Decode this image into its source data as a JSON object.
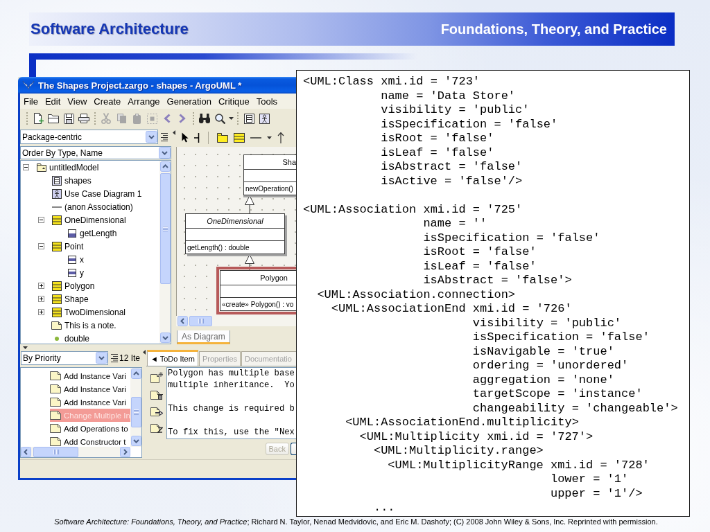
{
  "header": {
    "title": "Software Architecture",
    "subtitle": "Foundations, Theory, and Practice"
  },
  "window": {
    "title": "The Shapes Project.zargo - shapes - ArgoUML *",
    "menu": [
      "File",
      "Edit",
      "View",
      "Create",
      "Arrange",
      "Generation",
      "Critique",
      "Tools"
    ],
    "toolbar": [
      {
        "kind": "new",
        "disabled": false
      },
      {
        "kind": "open",
        "disabled": false
      },
      {
        "kind": "save",
        "disabled": false
      },
      {
        "kind": "print",
        "disabled": false
      },
      {
        "kind": "separator"
      },
      {
        "kind": "cut",
        "disabled": true
      },
      {
        "kind": "copy",
        "disabled": true
      },
      {
        "kind": "paste",
        "disabled": true
      },
      {
        "kind": "remove",
        "disabled": true
      },
      {
        "kind": "back",
        "disabled": false
      },
      {
        "kind": "forward",
        "disabled": false
      },
      {
        "kind": "separator"
      },
      {
        "kind": "find",
        "disabled": false
      },
      {
        "kind": "zoom",
        "disabled": false
      },
      {
        "kind": "dropdown",
        "disabled": false
      },
      {
        "kind": "separator"
      },
      {
        "kind": "class-diagram",
        "disabled": false
      },
      {
        "kind": "usecase-diagram",
        "disabled": false
      }
    ],
    "explorer": {
      "perspective": "Package-centric",
      "ordering": "Order By Type, Name",
      "tree": [
        {
          "label": "untitledModel",
          "kind": "model",
          "expanded": true,
          "selected": false,
          "children": [
            {
              "label": "shapes",
              "kind": "class-diagram",
              "selected": false
            },
            {
              "label": "Use Case Diagram 1",
              "kind": "usecase-diagram",
              "selected": false
            },
            {
              "label": "(anon Association)",
              "kind": "association",
              "selected": false
            },
            {
              "label": "OneDimensional",
              "kind": "class",
              "expanded": true,
              "selected": false,
              "children": [
                {
                  "label": "getLength",
                  "kind": "operation",
                  "selected": false
                }
              ]
            },
            {
              "label": "Point",
              "kind": "class",
              "expanded": true,
              "selected": false,
              "children": [
                {
                  "label": "x",
                  "kind": "attribute",
                  "selected": false
                },
                {
                  "label": "y",
                  "kind": "attribute",
                  "selected": false
                }
              ]
            },
            {
              "label": "Polygon",
              "kind": "class",
              "expanded": false,
              "selected": false
            },
            {
              "label": "Shape",
              "kind": "class",
              "expanded": false,
              "selected": false
            },
            {
              "label": "TwoDimensional",
              "kind": "class",
              "expanded": false,
              "selected": false
            },
            {
              "label": "This is a note.",
              "kind": "note",
              "selected": false
            },
            {
              "label": "double",
              "kind": "datatype",
              "selected": false
            }
          ]
        }
      ]
    },
    "diagram": {
      "toolbar": [
        {
          "kind": "select"
        },
        {
          "kind": "comment"
        },
        {
          "kind": "separator"
        },
        {
          "kind": "package"
        },
        {
          "kind": "class"
        },
        {
          "kind": "association"
        },
        {
          "kind": "dropdown"
        },
        {
          "kind": "generalization"
        }
      ],
      "classes": [
        {
          "name": "Sha",
          "operations": [
            "newOperation()"
          ],
          "abstract": false,
          "selected": false
        },
        {
          "name": "OneDimensional",
          "operations": [
            "getLength() : double"
          ],
          "abstract": true,
          "selected": false
        },
        {
          "name": "Polygon",
          "operations": [
            "«create» Polygon() : vo"
          ],
          "abstract": false,
          "selected": true
        }
      ],
      "tabs": [
        {
          "label": "As Diagram",
          "selected": true
        }
      ]
    },
    "todo": {
      "grouping": "By Priority",
      "count": "12 Ite",
      "items": [
        {
          "label": "Add Instance Vari",
          "selected": false
        },
        {
          "label": "Add Instance Vari",
          "selected": false
        },
        {
          "label": "Add Instance Vari",
          "selected": false
        },
        {
          "label": "Change Multiple In",
          "selected": true
        },
        {
          "label": "Add Operations to",
          "selected": false
        },
        {
          "label": "Add Constructor t",
          "selected": false
        }
      ]
    },
    "details": {
      "tabs": [
        {
          "label": "◄ ToDo Item",
          "selected": true,
          "disabled": false
        },
        {
          "label": "Properties",
          "selected": false,
          "disabled": true
        },
        {
          "label": "Documentatio",
          "selected": false,
          "disabled": true
        }
      ],
      "text": [
        [
          "Polygon has multiple base",
          "multiple inheritance.  Yo"
        ],
        [
          "This change is required b"
        ],
        [
          "To fix this, use the \"Nex"
        ]
      ],
      "buttons": [
        {
          "label": "Back",
          "disabled": true
        }
      ]
    }
  },
  "xmi": [
    {
      "lines": [
        "<UML:Class xmi.id = '723'",
        "name = 'Data Store'",
        "visibility = 'public'",
        "isSpecification = 'false'",
        "isRoot = 'false'",
        "isLeaf = 'false'",
        "isAbstract = 'false'",
        "isActive = 'false'/>"
      ]
    },
    {
      "lines": [
        "<UML:Association xmi.id = '725'",
        "name = ''",
        "isSpecification = 'false'",
        "isRoot = 'false'",
        "isLeaf = 'false'",
        "isAbstract = 'false'>"
      ],
      "children": [
        {
          "lines": [
            "<UML:Association.connection>"
          ],
          "children": [
            {
              "lines": [
                "<UML:AssociationEnd xmi.id = '726'",
                "visibility = 'public'",
                "isSpecification = 'false'",
                "isNavigable = 'true'",
                "ordering = 'unordered'",
                "aggregation = 'none'",
                "targetScope = 'instance'",
                "changeability = 'changeable'>"
              ],
              "children": [
                {
                  "lines": [
                    "<UML:AssociationEnd.multiplicity>"
                  ],
                  "children": [
                    {
                      "lines": [
                        "<UML:Multiplicity xmi.id = '727'>"
                      ],
                      "children": [
                        {
                          "lines": [
                            "<UML:Multiplicity.range>"
                          ],
                          "children": [
                            {
                              "lines": [
                                "<UML:MultiplicityRange xmi.id = '728'",
                                "lower = '1'",
                                "upper = '1'/>"
                              ]
                            }
                          ]
                        },
                        {
                          "lines": [
                            "..."
                          ]
                        }
                      ]
                    }
                  ]
                }
              ]
            }
          ]
        }
      ]
    }
  ],
  "footer": "*Software Architecture: Foundations, Theory, and Practice*; Richard N. Taylor, Nenad Medvidovic, and Eric M. Dashofy; (C) 2008 John Wiley & Sons, Inc. Reprinted with permission."
}
